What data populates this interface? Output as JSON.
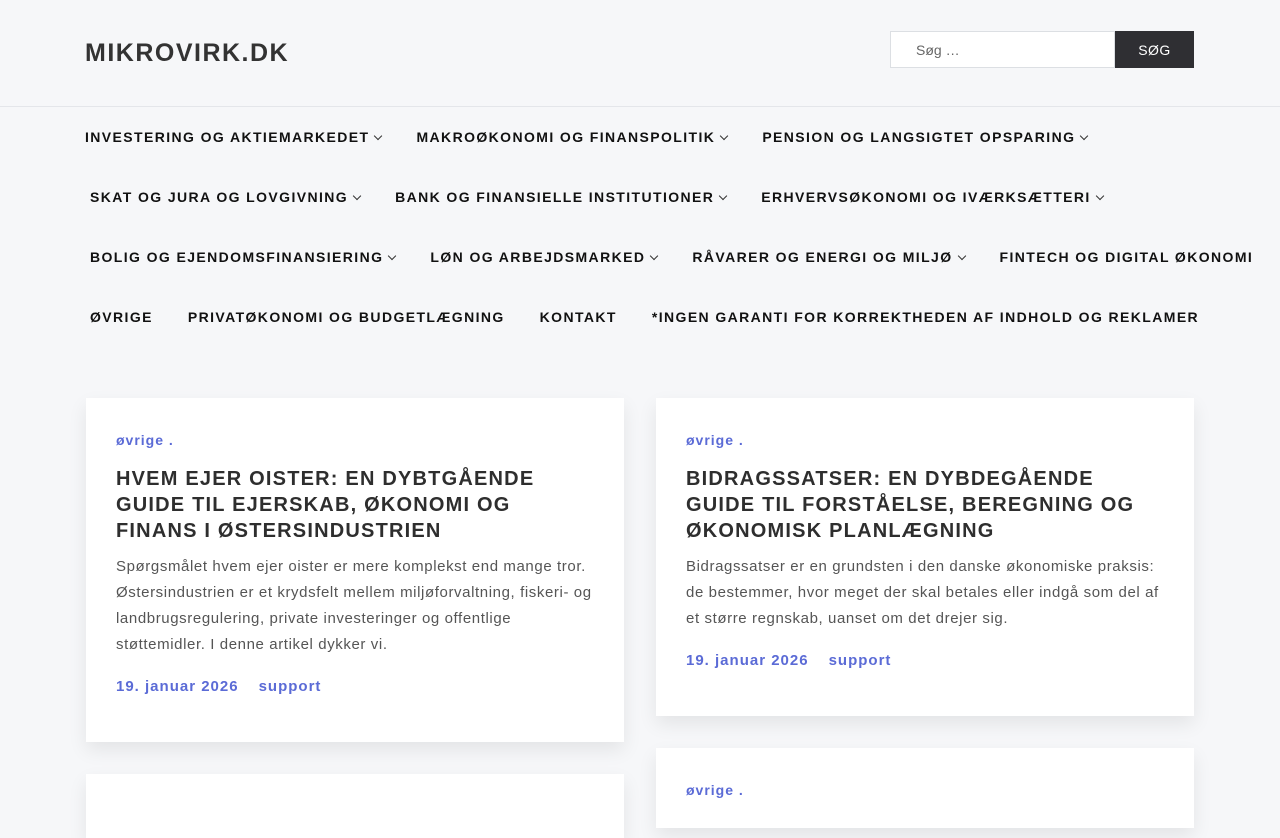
{
  "site": {
    "title": "MIKROVIRK.DK"
  },
  "search": {
    "placeholder": "Søg …",
    "button_label": "SØG"
  },
  "nav": {
    "rows": [
      [
        {
          "label": "INVESTERING OG AKTIEMARKEDET",
          "has_submenu": true
        },
        {
          "label": "MAKROØKONOMI OG FINANSPOLITIK",
          "has_submenu": true
        },
        {
          "label": "PENSION OG LANGSIGTET OPSPARING",
          "has_submenu": true
        }
      ],
      [
        {
          "label": "SKAT OG JURA OG LOVGIVNING",
          "has_submenu": true
        },
        {
          "label": "BANK OG FINANSIELLE INSTITUTIONER",
          "has_submenu": true
        },
        {
          "label": "ERHVERVSØKONOMI OG IVÆRKSÆTTERI",
          "has_submenu": true
        }
      ],
      [
        {
          "label": "BOLIG OG EJENDOMSFINANSIERING",
          "has_submenu": true
        },
        {
          "label": "LØN OG ARBEJDSMARKED",
          "has_submenu": true
        },
        {
          "label": "RÅVARER OG ENERGI OG MILJØ",
          "has_submenu": true
        },
        {
          "label": "FINTECH OG DIGITAL ØKONOMI",
          "has_submenu": false
        }
      ],
      [
        {
          "label": "ØVRIGE",
          "has_submenu": false
        },
        {
          "label": "PRIVATØKONOMI OG BUDGETLÆGNING",
          "has_submenu": false
        },
        {
          "label": "KONTAKT",
          "has_submenu": false
        },
        {
          "label": "*INGEN GARANTI FOR KORREKTHEDEN AF INDHOLD OG REKLAMER",
          "has_submenu": false
        }
      ]
    ]
  },
  "posts": [
    {
      "category": "øvrige .",
      "title": "HVEM EJER OISTER: EN DYBTGÅENDE GUIDE TIL EJERSKAB, ØKONOMI OG FINANS I ØSTERSINDUSTRIEN",
      "excerpt": "Spørgsmålet hvem ejer oister er mere komplekst end mange tror. Østersindustrien er et krydsfelt mellem miljøforvaltning, fiskeri- og landbrugsregulering, private investeringer og offentlige støttemidler. I denne artikel dykker vi.",
      "date": "19. januar 2026",
      "author": "support"
    },
    {
      "category": "øvrige .",
      "title": "BIDRAGSSATSER: EN DYBDEGÅENDE GUIDE TIL FORSTÅELSE, BEREGNING OG ØKONOMISK PLANLÆGNING",
      "excerpt": "Bidragssatser er en grundsten i den danske økonomiske praksis: de bestemmer, hvor meget der skal betales eller indgå som del af et større regnskab, uanset om det drejer sig.",
      "date": "19. januar 2026",
      "author": "support"
    },
    {
      "category": "",
      "title": "",
      "excerpt": "",
      "date": "",
      "author": ""
    },
    {
      "category": "øvrige .",
      "title": "",
      "excerpt": "",
      "date": "",
      "author": ""
    }
  ],
  "colors": {
    "accent": "#5b6bd6",
    "background": "#f6f7f9",
    "button": "#2f2f33"
  }
}
